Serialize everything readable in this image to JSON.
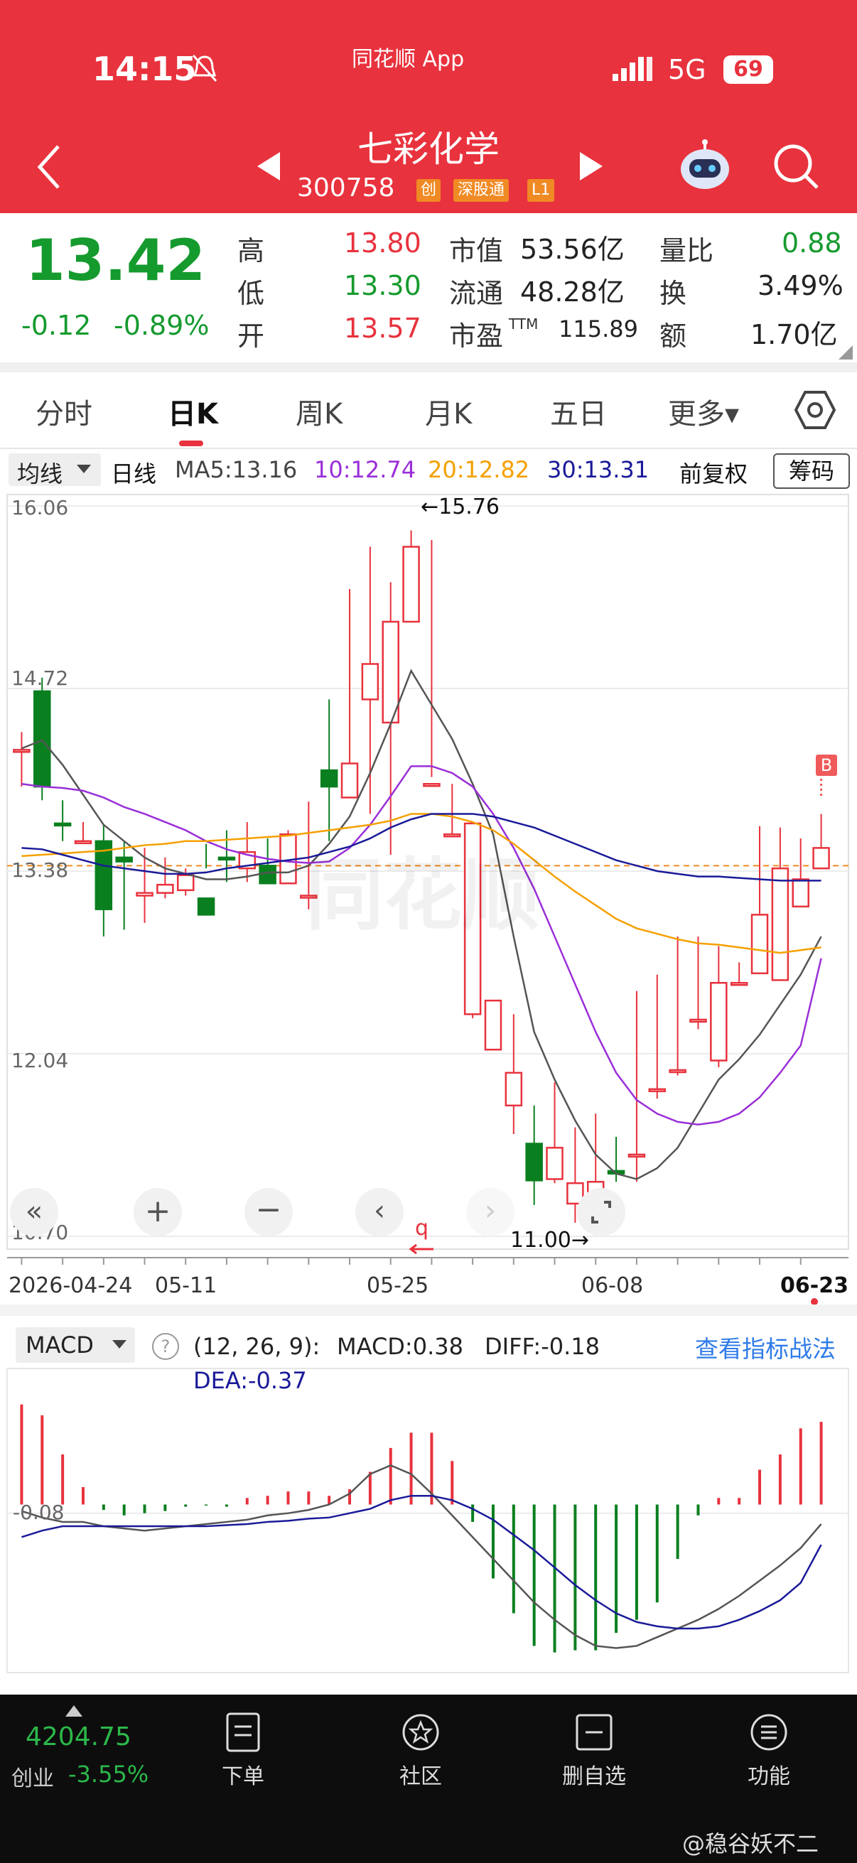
{
  "status": {
    "time": "14:15",
    "app": "同花顺 App",
    "network": "5G",
    "battery": "69"
  },
  "header": {
    "title": "七彩化学",
    "code": "300758",
    "tags": [
      "创",
      "深股通",
      "L1"
    ]
  },
  "quote": {
    "price": "13.42",
    "change": "-0.12",
    "change_pct": "-0.89%",
    "high_label": "高",
    "high": "13.80",
    "low_label": "低",
    "low": "13.30",
    "open_label": "开",
    "open": "13.57",
    "mcap_label": "市值",
    "mcap": "53.56亿",
    "float_label": "流通",
    "float": "48.28亿",
    "pe_label": "市盈",
    "pe_sup": "TTM",
    "pe": "115.89",
    "vr_label": "量比",
    "vr": "0.88",
    "turn_label": "换",
    "turn": "3.49%",
    "amount_label": "额",
    "amount": "1.70亿"
  },
  "tabs": [
    "分时",
    "日K",
    "周K",
    "月K",
    "五日",
    "更多▾"
  ],
  "ma_bar": {
    "type": "均线",
    "period": "日线",
    "ma5": "MA5:13.16",
    "ma10": "10:12.74",
    "ma20": "20:12.82",
    "ma30": "30:13.31",
    "adj": "前复权",
    "chips": "筹码"
  },
  "kline": {
    "ylabels": [
      "16.06",
      "14.72",
      "13.38",
      "12.04",
      "10.70"
    ],
    "max_label": "←15.76",
    "min_label": "11.00→",
    "xlabels": [
      "2026-04-24",
      "05-11",
      "05-25",
      "06-08",
      "06-23"
    ],
    "b_marker": "B",
    "watermark": "同花顺"
  },
  "macd": {
    "label": "MACD",
    "params": "(12, 26, 9):",
    "macd": "MACD:0.38",
    "diff": "DIFF:-0.18",
    "dea": "DEA:-0.37",
    "link": "查看指标战法",
    "ylabel": "-0.08"
  },
  "bottom": {
    "index_value": "4204.75",
    "index_name": "创业",
    "index_pct": "-3.55%",
    "items": [
      "下单",
      "社区",
      "删自选",
      "功能"
    ],
    "credit": "@稳谷妖不二"
  },
  "chart_data": {
    "type": "candlestick",
    "x": [
      "2026-04-24",
      "04-27",
      "04-28",
      "04-29",
      "04-30",
      "05-06",
      "05-07",
      "05-08",
      "05-11",
      "05-12",
      "05-13",
      "05-14",
      "05-15",
      "05-18",
      "05-19",
      "05-20",
      "05-21",
      "05-22",
      "05-25",
      "05-26",
      "05-27",
      "05-28",
      "05-29",
      "06-01",
      "06-02",
      "06-03",
      "06-04",
      "06-05",
      "06-08",
      "06-09",
      "06-10",
      "06-11",
      "06-12",
      "06-15",
      "06-16",
      "06-17",
      "06-18",
      "06-19",
      "06-22",
      "06-23"
    ],
    "open": [
      14.27,
      14.7,
      13.73,
      13.6,
      13.6,
      13.48,
      13.2,
      13.22,
      13.24,
      13.18,
      13.48,
      13.4,
      13.42,
      13.29,
      13.2,
      14.12,
      13.92,
      14.64,
      14.47,
      15.21,
      14.02,
      13.65,
      12.33,
      12.07,
      11.66,
      11.38,
      11.12,
      10.94,
      10.87,
      11.18,
      11.3,
      11.78,
      11.92,
      12.29,
      11.99,
      12.56,
      12.63,
      12.58,
      13.12,
      13.4
    ],
    "close": [
      14.27,
      14.0,
      13.72,
      13.6,
      13.1,
      13.45,
      13.22,
      13.28,
      13.35,
      13.06,
      13.47,
      13.52,
      13.29,
      13.65,
      13.2,
      14.0,
      14.17,
      14.9,
      15.21,
      15.76,
      14.02,
      13.65,
      13.73,
      12.43,
      11.9,
      11.11,
      11.35,
      11.09,
      11.1,
      11.16,
      11.3,
      11.78,
      11.92,
      12.29,
      12.56,
      12.56,
      13.06,
      13.4,
      13.32,
      13.55
    ],
    "high": [
      14.4,
      14.8,
      13.9,
      13.74,
      13.72,
      13.6,
      13.55,
      13.48,
      13.4,
      13.58,
      13.68,
      13.74,
      13.62,
      13.68,
      13.89,
      14.64,
      15.45,
      15.76,
      15.5,
      15.88,
      15.81,
      14.02,
      13.73,
      12.43,
      12.33,
      11.66,
      11.83,
      11.5,
      11.6,
      11.43,
      12.5,
      12.62,
      12.9,
      12.9,
      12.83,
      12.71,
      13.71,
      13.7,
      13.62,
      13.8
    ],
    "low": [
      14.0,
      13.9,
      13.6,
      13.58,
      12.9,
      12.95,
      13.0,
      13.18,
      13.2,
      13.4,
      13.3,
      13.3,
      13.3,
      13.32,
      13.1,
      13.6,
      13.92,
      13.8,
      13.5,
      15.21,
      14.07,
      13.65,
      12.3,
      12.07,
      11.45,
      10.93,
      11.09,
      10.8,
      11.0,
      11.1,
      11.1,
      11.71,
      11.88,
      12.22,
      11.94,
      12.56,
      12.63,
      12.58,
      13.12,
      13.4
    ],
    "ma5": [
      14.28,
      14.34,
      14.16,
      13.94,
      13.72,
      13.6,
      13.48,
      13.4,
      13.36,
      13.32,
      13.32,
      13.34,
      13.37,
      13.37,
      13.42,
      13.58,
      13.78,
      14.1,
      14.46,
      14.85,
      14.6,
      14.35,
      14.02,
      13.65,
      12.9,
      12.2,
      11.85,
      11.55,
      11.3,
      11.16,
      11.12,
      11.2,
      11.35,
      11.6,
      11.85,
      12.0,
      12.18,
      12.4,
      12.62,
      12.9
    ],
    "ma10": [
      14.02,
      14.0,
      13.99,
      13.97,
      13.92,
      13.85,
      13.8,
      13.74,
      13.68,
      13.6,
      13.54,
      13.5,
      13.47,
      13.45,
      13.44,
      13.45,
      13.55,
      13.72,
      13.93,
      14.15,
      14.15,
      14.1,
      14.0,
      13.8,
      13.55,
      13.25,
      12.9,
      12.55,
      12.2,
      11.9,
      11.7,
      11.6,
      11.54,
      11.52,
      11.54,
      11.6,
      11.72,
      11.9,
      12.1,
      12.74
    ],
    "ma20": [
      13.49,
      13.5,
      13.51,
      13.52,
      13.53,
      13.55,
      13.57,
      13.58,
      13.6,
      13.6,
      13.61,
      13.62,
      13.63,
      13.64,
      13.66,
      13.68,
      13.7,
      13.72,
      13.75,
      13.8,
      13.8,
      13.78,
      13.74,
      13.68,
      13.58,
      13.46,
      13.34,
      13.23,
      13.13,
      13.03,
      12.96,
      12.92,
      12.88,
      12.85,
      12.84,
      12.82,
      12.8,
      12.78,
      12.8,
      12.82
    ],
    "ma30": [
      13.55,
      13.54,
      13.5,
      13.46,
      13.42,
      13.4,
      13.38,
      13.36,
      13.36,
      13.37,
      13.4,
      13.42,
      13.44,
      13.46,
      13.48,
      13.52,
      13.56,
      13.62,
      13.7,
      13.76,
      13.8,
      13.8,
      13.8,
      13.78,
      13.74,
      13.7,
      13.64,
      13.58,
      13.52,
      13.46,
      13.42,
      13.38,
      13.36,
      13.34,
      13.34,
      13.33,
      13.32,
      13.31,
      13.31,
      13.31
    ],
    "ylim": [
      10.7,
      16.06
    ],
    "hline": 13.42,
    "macd_hist": [
      0.92,
      0.82,
      0.46,
      0.16,
      -0.05,
      -0.1,
      -0.08,
      -0.06,
      -0.02,
      -0.01,
      -0.02,
      0.06,
      0.08,
      0.12,
      0.12,
      0.08,
      0.14,
      0.3,
      0.52,
      0.66,
      0.66,
      0.4,
      -0.16,
      -0.68,
      -1.0,
      -1.3,
      -1.36,
      -1.34,
      -1.34,
      -1.18,
      -1.06,
      -0.9,
      -0.5,
      -0.1,
      0.06,
      0.06,
      0.32,
      0.46,
      0.7,
      0.76
    ],
    "diff": [
      -0.06,
      -0.12,
      -0.16,
      -0.16,
      -0.2,
      -0.22,
      -0.24,
      -0.22,
      -0.2,
      -0.18,
      -0.16,
      -0.14,
      -0.1,
      -0.08,
      -0.05,
      0.0,
      0.1,
      0.28,
      0.36,
      0.28,
      0.1,
      -0.1,
      -0.3,
      -0.5,
      -0.7,
      -0.9,
      -1.06,
      -1.2,
      -1.3,
      -1.32,
      -1.3,
      -1.22,
      -1.14,
      -1.06,
      -0.96,
      -0.84,
      -0.7,
      -0.56,
      -0.4,
      -0.18
    ],
    "dea": [
      -0.3,
      -0.24,
      -0.2,
      -0.2,
      -0.2,
      -0.2,
      -0.2,
      -0.2,
      -0.2,
      -0.2,
      -0.19,
      -0.18,
      -0.16,
      -0.15,
      -0.13,
      -0.12,
      -0.08,
      -0.04,
      0.04,
      0.08,
      0.08,
      0.04,
      -0.04,
      -0.14,
      -0.28,
      -0.42,
      -0.58,
      -0.74,
      -0.88,
      -1.0,
      -1.08,
      -1.12,
      -1.14,
      -1.14,
      -1.12,
      -1.06,
      -0.98,
      -0.88,
      -0.72,
      -0.37
    ],
    "macd_ylim": [
      -1.48,
      1.12
    ]
  }
}
